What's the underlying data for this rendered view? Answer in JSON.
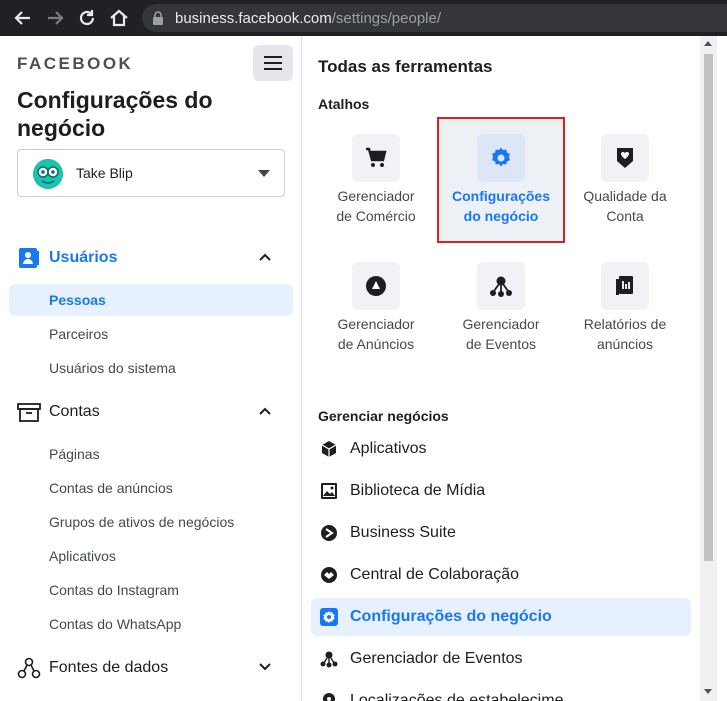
{
  "browser": {
    "url_domain": "business.facebook.com",
    "url_path": "/settings/people/"
  },
  "sidebar": {
    "brand": "FACEBOOK",
    "title": "Configurações do negócio",
    "account_name": "Take Blip",
    "sections": [
      {
        "label": "Usuários",
        "items": [
          "Pessoas",
          "Parceiros",
          "Usuários do sistema"
        ]
      },
      {
        "label": "Contas",
        "items": [
          "Páginas",
          "Contas de anúncios",
          "Grupos de ativos de negócios",
          "Aplicativos",
          "Contas do Instagram",
          "Contas do WhatsApp"
        ]
      },
      {
        "label": "Fontes de dados",
        "items": []
      }
    ]
  },
  "main": {
    "title": "Todas as ferramentas",
    "shortcuts_label": "Atalhos",
    "shortcuts": [
      {
        "line1": "Gerenciador",
        "line2": "de Comércio"
      },
      {
        "line1": "Configurações",
        "line2": "do negócio"
      },
      {
        "line1": "Qualidade da",
        "line2": "Conta"
      },
      {
        "line1": "Gerenciador",
        "line2": "de Anúncios"
      },
      {
        "line1": "Gerenciador",
        "line2": "de Eventos"
      },
      {
        "line1": "Relatórios de",
        "line2": "anúncios"
      }
    ],
    "manage_label": "Gerenciar negócios",
    "manage_items": [
      "Aplicativos",
      "Biblioteca de Mídia",
      "Business Suite",
      "Central de Colaboração",
      "Configurações do negócio",
      "Gerenciador de Eventos",
      "Localizações de estabelecime"
    ]
  },
  "colors": {
    "accent": "#1877f2",
    "selected_bg": "#e7f0fd",
    "highlight_border": "#e02020"
  }
}
